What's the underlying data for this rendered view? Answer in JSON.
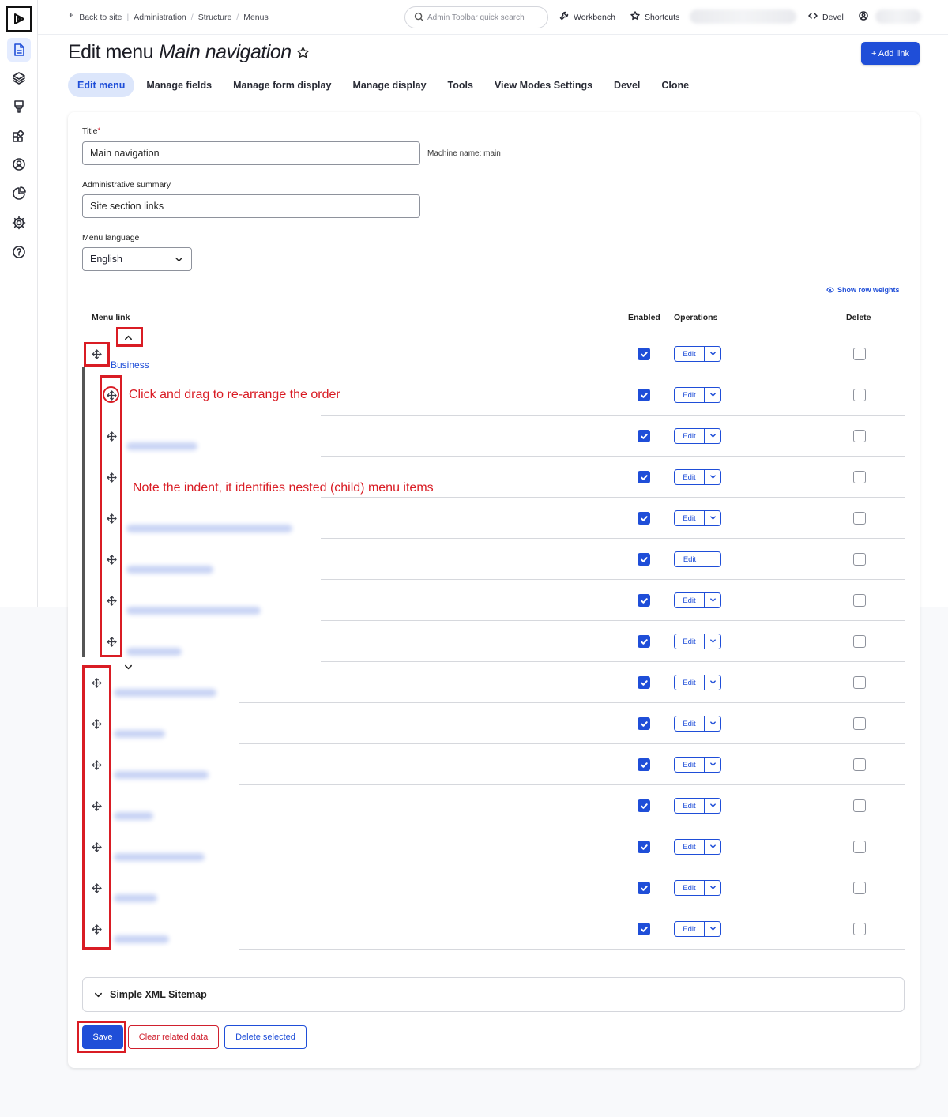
{
  "toolbar": {
    "back_label": "Back to site",
    "breadcrumbs": [
      "Administration",
      "Structure",
      "Menus"
    ],
    "search_placeholder": "Admin Toolbar quick search",
    "workbench_label": "Workbench",
    "shortcuts_label": "Shortcuts",
    "devel_label": "Devel"
  },
  "page": {
    "title_prefix": "Edit menu",
    "title_name": "Main navigation",
    "add_link_label": "+ Add link"
  },
  "tabs": [
    {
      "label": "Edit menu",
      "active": true
    },
    {
      "label": "Manage fields",
      "active": false
    },
    {
      "label": "Manage form display",
      "active": false
    },
    {
      "label": "Manage display",
      "active": false
    },
    {
      "label": "Tools",
      "active": false
    },
    {
      "label": "View Modes Settings",
      "active": false
    },
    {
      "label": "Devel",
      "active": false
    },
    {
      "label": "Clone",
      "active": false
    }
  ],
  "form": {
    "title_label": "Title",
    "title_required_mark": "*",
    "title_value": "Main navigation",
    "machine_name": "Machine name: main",
    "summary_label": "Administrative summary",
    "summary_value": "Site section links",
    "language_label": "Menu language",
    "language_value": "English"
  },
  "table": {
    "show_weights_label": "Show row weights",
    "headers": {
      "menu_link": "Menu link",
      "enabled": "Enabled",
      "operations": "Operations",
      "delete": "Delete"
    },
    "edit_label": "Edit",
    "first_link": "Business"
  },
  "annotations": {
    "drag_note": "Click and drag to re-arrange the order",
    "indent_note": "Note the indent, it identifies nested (child) menu items"
  },
  "sitemap_label": "Simple XML Sitemap",
  "buttons": {
    "save": "Save",
    "clear": "Clear related data",
    "delete_selected": "Delete selected"
  },
  "colors": {
    "accent": "#1f4ed8",
    "danger": "#d0202e",
    "annotation": "#d91c24"
  }
}
